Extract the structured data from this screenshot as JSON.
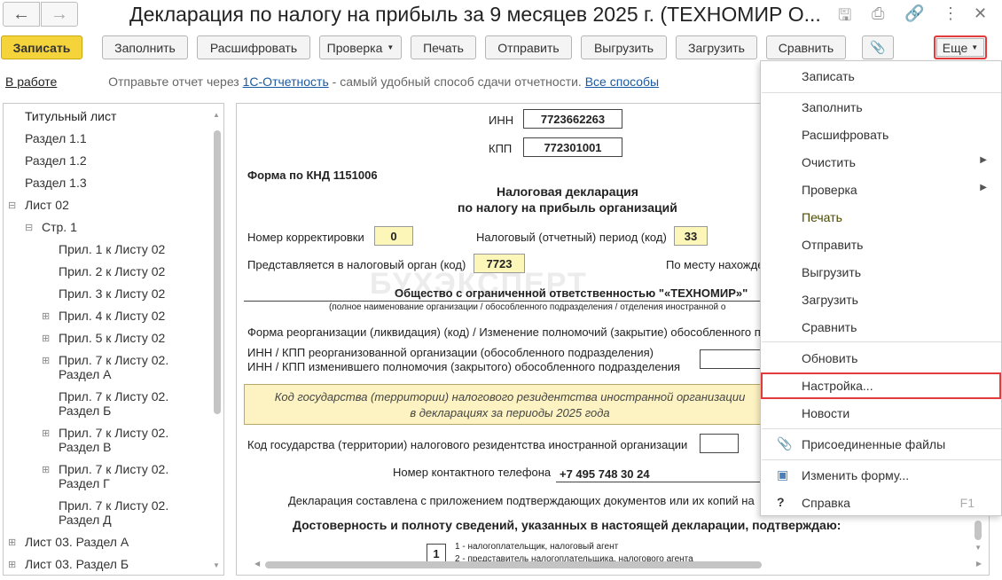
{
  "window": {
    "title": "Декларация по налогу на прибыль за 9 месяцев 2025 г. (ТЕХНОМИР О..."
  },
  "toolbar": {
    "save": "Записать",
    "fill": "Заполнить",
    "decode": "Расшифровать",
    "check": "Проверка",
    "print": "Печать",
    "send": "Отправить",
    "export": "Выгрузить",
    "import": "Загрузить",
    "compare": "Сравнить",
    "more": "Еще"
  },
  "status": {
    "state": "В работе",
    "hint_prefix": "Отправьте отчет через",
    "hint_link": "1С-Отчетность",
    "hint_middle": "- самый удобный способ сдачи отчетности.",
    "all_ways": "Все способы"
  },
  "tree": {
    "items": [
      {
        "label": "Титульный лист"
      },
      {
        "label": "Раздел 1.1"
      },
      {
        "label": "Раздел 1.2"
      },
      {
        "label": "Раздел 1.3"
      },
      {
        "label": "Лист 02"
      },
      {
        "label": "Стр. 1"
      },
      {
        "label": "Прил. 1 к Листу 02"
      },
      {
        "label": "Прил. 2 к Листу 02"
      },
      {
        "label": "Прил. 3 к Листу 02"
      },
      {
        "label": "Прил. 4 к Листу 02"
      },
      {
        "label": "Прил. 5 к Листу 02"
      },
      {
        "label": "Прил. 7 к Листу 02.",
        "label2": "Раздел А"
      },
      {
        "label": "Прил. 7 к Листу 02.",
        "label2": "Раздел Б"
      },
      {
        "label": "Прил. 7 к Листу 02.",
        "label2": "Раздел В"
      },
      {
        "label": "Прил. 7 к Листу 02.",
        "label2": "Раздел Г"
      },
      {
        "label": "Прил. 7 к Листу 02.",
        "label2": "Раздел Д"
      },
      {
        "label": "Лист 03. Раздел А"
      },
      {
        "label": "Лист 03. Раздел Б"
      }
    ]
  },
  "form": {
    "inn_label": "ИНН",
    "inn": "7723662263",
    "kpp_label": "КПП",
    "kpp": "772301001",
    "knd": "Форма по КНД 1151006",
    "heading1": "Налоговая декларация",
    "heading2": "по налогу на прибыль организаций",
    "correction_label": "Номер корректировки",
    "correction": "0",
    "period_label": "Налоговый (отчетный) период (код)",
    "period": "33",
    "authority_label": "Представляется в налоговый орган (код)",
    "authority": "7723",
    "location_label": "По месту нахожде",
    "org_name": "Общество с ограниченной ответственностью \"«ТЕХНОМИР»\"",
    "org_caption": "(полное наименование организации / обособленного подразделения / отделения иностранной о",
    "reorg_label": "Форма реорганизации (ликвидация) (код) / Изменение полномочий (закрытие) обособленного под",
    "reorg_inn1": "ИНН / КПП реорганизованной организации (обособленного подразделения)",
    "reorg_inn2": "ИНН / КПП изменившего полномочия (закрытого) обособленного подразделения",
    "note1": "Код государства (территории) налогового резидентства иностранной организации",
    "note2": "в декларациях за периоды 2025 года",
    "country_label": "Код государства (территории) налогового резидентства иностранной организации",
    "phone_label": "Номер контактного телефона",
    "phone": "+7 495 748 30 24",
    "attached_label": "Декларация составлена с приложением подтверждающих документов или их копий на",
    "confirm": "Достоверность и полноту сведений, указанных в настоящей декларации, подтверждаю:",
    "signer_code": "1",
    "signer_opt1": "1 - налогоплательщик, налоговый агент",
    "signer_opt2": "2 - представитель налогоплательщика, налогового агента",
    "watermark": "БУХЭКСПЕРТ"
  },
  "menu": {
    "save": "Записать",
    "fill": "Заполнить",
    "decode": "Расшифровать",
    "clear": "Очистить",
    "check": "Проверка",
    "print": "Печать",
    "send": "Отправить",
    "export": "Выгрузить",
    "import": "Загрузить",
    "compare": "Сравнить",
    "refresh": "Обновить",
    "settings": "Настройка...",
    "news": "Новости",
    "attached": "Присоединенные файлы",
    "change_form": "Изменить форму...",
    "help": "Справка",
    "help_shortcut": "F1"
  },
  "colors": {
    "primary_button": "#f5d33b",
    "highlight": "#e23b3b",
    "link": "#1a5aa3",
    "field_yellow": "#fdf6b9"
  },
  "icons": [
    "back-arrow-icon",
    "forward-arrow-icon",
    "save-disk-icon",
    "print-icon",
    "link-icon",
    "more-vert-icon",
    "close-icon",
    "paperclip-icon",
    "help-icon",
    "form-icon"
  ]
}
